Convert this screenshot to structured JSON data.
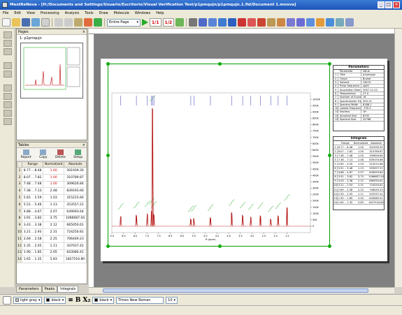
{
  "window": {
    "title": "MestReNova - [H:/Documents and Settings/Usuario/Escritorio/Visual Verification Test/p1pmqujn/p1pmqujn.1.fid/Document 1.mnova]"
  },
  "menu": [
    "File",
    "Edit",
    "View",
    "Processing",
    "Analysis",
    "Tools",
    "Draw",
    "Molecule",
    "Windows",
    "Help"
  ],
  "toolbar": {
    "zoom_value": "Entire Page",
    "page_buttons": [
      "1/1",
      "1/2"
    ]
  },
  "pages_panel": {
    "title": "Pages",
    "items": [
      "1: p1pmqujn"
    ]
  },
  "tables_panel": {
    "title": "Tables",
    "tools": [
      "Report",
      "Copy",
      "Delete",
      "Setup"
    ],
    "columns": [
      "",
      "Range",
      "Normalized",
      "Absolute"
    ],
    "rows": [
      [
        "1",
        "8.77 .. 8.48",
        "1.00",
        "301939.30"
      ],
      [
        "2",
        "8.07 .. 7.82",
        "1.00",
        "310789.87"
      ],
      [
        "3",
        "7.48 .. 7.48",
        "1.00",
        "309626.84"
      ],
      [
        "4",
        "7.38 .. 7.13",
        "2.48",
        "839193.66"
      ],
      [
        "5",
        "5.65 .. 5.59",
        "1.03",
        "315215.66"
      ],
      [
        "6",
        "5.51 .. 5.46",
        "1.13",
        "353557.21"
      ],
      [
        "7",
        "4.88 .. 4.67",
        "2.07",
        "649093.64"
      ],
      [
        "8",
        "3.91 .. 3.82",
        "3.75",
        "1066687.04"
      ],
      [
        "9",
        "3.43 .. 3.38",
        "2.12",
        "665050.61"
      ],
      [
        "10",
        "3.21 .. 2.93",
        "2.31",
        "724250.81"
      ],
      [
        "11",
        "2.69 .. 2.58",
        "2.25",
        "706449.23"
      ],
      [
        "12",
        "2.35 .. 2.05",
        "1.11",
        "347037.41"
      ],
      [
        "13",
        "1.90 .. 1.85",
        "2.05",
        "643080.41"
      ],
      [
        "14",
        "1.65 .. 1.35",
        "5.83",
        "1827516.80"
      ]
    ]
  },
  "panel_tabs": [
    "Parameters",
    "Peaks",
    "Integrals"
  ],
  "parameters": {
    "title": "Parameters",
    "header": [
      "",
      "Parameter",
      "Value"
    ],
    "rows": [
      [
        "1",
        "Title",
        "p1pmqujn"
      ],
      [
        "2",
        "Origin",
        "Bruker"
      ],
      [
        "3",
        "Solvent",
        "CDCl3"
      ],
      [
        "4",
        "Pulse Sequence",
        "zg30"
      ],
      [
        "5",
        "Acquisition Date",
        "2007-11-22"
      ],
      [
        "6",
        "Temperature",
        "27.0"
      ],
      [
        "7",
        "Number of Scans",
        "16"
      ],
      [
        "8",
        "Spectrometer Frequency",
        "300.13"
      ],
      [
        "9",
        "Spectral Width",
        "6188.1"
      ],
      [
        "10",
        "Lowest Frequency",
        "-755.3"
      ],
      [
        "11",
        "Nucleus",
        "1H"
      ],
      [
        "12",
        "Acquired Size",
        "8192"
      ],
      [
        "13",
        "Spectral Size",
        "32768"
      ]
    ]
  },
  "integrals_table": {
    "title": "Integrals",
    "header": [
      "",
      "Range",
      "Normalized",
      "Absolute"
    ],
    "rows": [
      [
        "1",
        "8.77 .. 8.48",
        "1.00",
        "301939.30"
      ],
      [
        "2",
        "8.07 .. 7.82",
        "1.00",
        "310789.87"
      ],
      [
        "3",
        "7.48 .. 7.48",
        "1.00",
        "309626.84"
      ],
      [
        "4",
        "7.38 .. 7.13",
        "2.48",
        "839193.66"
      ],
      [
        "5",
        "5.65 .. 5.59",
        "1.03",
        "315215.66"
      ],
      [
        "6",
        "5.51 .. 5.46",
        "1.13",
        "353557.21"
      ],
      [
        "7",
        "4.88 .. 4.67",
        "2.07",
        "649093.64"
      ],
      [
        "8",
        "3.91 .. 3.82",
        "3.75",
        "1066687.04"
      ],
      [
        "9",
        "3.43 .. 3.38",
        "2.12",
        "665050.61"
      ],
      [
        "10",
        "3.21 .. 2.93",
        "2.31",
        "724250.81"
      ],
      [
        "11",
        "2.69 .. 2.58",
        "2.25",
        "706449.23"
      ],
      [
        "12",
        "2.35 .. 2.05",
        "1.11",
        "347037.41"
      ],
      [
        "13",
        "1.90 .. 1.85",
        "2.05",
        "643080.41"
      ],
      [
        "14",
        "1.65 .. 1.35",
        "5.83",
        "1827516.80"
      ]
    ]
  },
  "bottombar": {
    "fill_color": "light gray",
    "line_color": "black",
    "text_color": "black",
    "font": "Times New Roman",
    "font_size": "10"
  },
  "chart_data": {
    "type": "line",
    "xlabel": "ft (ppm)",
    "xlim": [
      9.0,
      0.5
    ],
    "ylim": [
      -50000,
      1050000
    ],
    "x_ticks": [
      "9.0",
      "8.5",
      "8.0",
      "7.5",
      "7.0",
      "6.5",
      "6.0",
      "5.5",
      "5.0",
      "4.5",
      "4.0",
      "3.5",
      "3.0",
      "2.5",
      "2.0",
      "1.5"
    ],
    "y_ticks": [
      "1000K",
      "950K",
      "900K",
      "850K",
      "800K",
      "750K",
      "700K",
      "650K",
      "600K",
      "550K",
      "500K",
      "450K",
      "400K",
      "350K",
      "300K",
      "250K",
      "200K",
      "150K",
      "100K",
      "50K",
      "0"
    ],
    "peaks": [
      {
        "x": 8.62,
        "y": 80000
      },
      {
        "x": 7.95,
        "y": 90000
      },
      {
        "x": 7.48,
        "y": 100000
      },
      {
        "x": 7.3,
        "y": 120000
      },
      {
        "x": 7.2,
        "y": 95000
      },
      {
        "x": 5.62,
        "y": 60000
      },
      {
        "x": 5.49,
        "y": 65000
      },
      {
        "x": 4.78,
        "y": 70000
      },
      {
        "x": 3.87,
        "y": 110000
      },
      {
        "x": 3.4,
        "y": 90000
      },
      {
        "x": 3.05,
        "y": 75000
      },
      {
        "x": 2.64,
        "y": 85000
      },
      {
        "x": 2.2,
        "y": 60000
      },
      {
        "x": 1.88,
        "y": 85000
      },
      {
        "x": 1.5,
        "y": 150000
      },
      {
        "x": 7.26,
        "y": 930000
      }
    ],
    "colors": {
      "spectrum": "#b00000",
      "integral": "#00a000",
      "multiplet": "#0000a0"
    }
  }
}
